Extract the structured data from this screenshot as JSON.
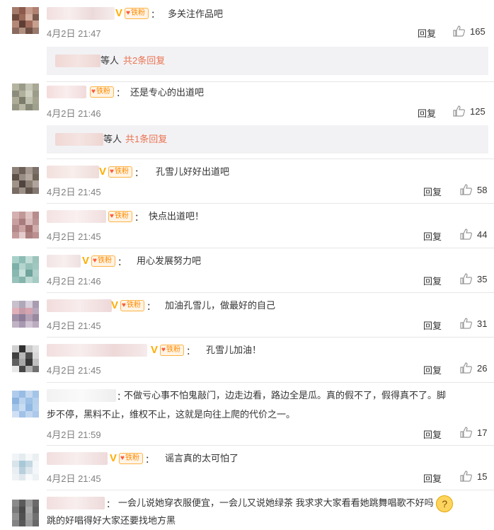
{
  "comments": [
    {
      "text": "多关注作品吧",
      "time": "4月2日 21:47",
      "reply": "回复",
      "likes": "165"
    },
    {
      "text": "还是专心的出道吧",
      "time": "4月2日 21:46",
      "reply": "回复",
      "likes": "125"
    },
    {
      "text": "孔雪儿好好出道吧",
      "time": "4月2日 21:45",
      "reply": "回复",
      "likes": "58"
    },
    {
      "text": "快点出道吧！",
      "time": "4月2日 21:45",
      "reply": "回复",
      "likes": "44"
    },
    {
      "text": "用心发展努力吧",
      "time": "4月2日 21:46",
      "reply": "回复",
      "likes": "35"
    },
    {
      "text": "加油孔雪儿，做最好的自己",
      "time": "4月2日 21:45",
      "reply": "回复",
      "likes": "31"
    },
    {
      "text": "孔雪儿加油！",
      "time": "4月2日 21:45",
      "reply": "回复",
      "likes": "26"
    },
    {
      "text_line1": "不做亏心事不怕鬼敲门，边走边看，路边全是瓜。真的假不了，假得真不了。脚",
      "text_line2": "步不停，黑料不止，维权不止，这就是向往上爬的代价之一。",
      "time": "4月2日 21:59",
      "reply": "回复",
      "likes": "17"
    },
    {
      "text": "谣言真的太可怕了",
      "time": "4月2日 21:45",
      "reply": "回复",
      "likes": "15"
    },
    {
      "text_line1": "一会儿说她穿衣服便宜，一会儿又说她绿茶 我求求大家看看她跳舞唱歌不好吗",
      "text_line2": "跳的好唱得好大家还要找地方黑"
    }
  ],
  "subreplies": [
    {
      "suffix": "等人",
      "count": "共2条回复"
    },
    {
      "suffix": "等人",
      "count": "共1条回复"
    }
  ],
  "fan_badge": "铁粉",
  "colon": "：",
  "vip_mark": "V",
  "emoji_label": "?",
  "colors": {
    "link": "#eb7350",
    "gray": "#808080",
    "vip": "#ffad00"
  },
  "icons": [
    "thumbs-up-icon",
    "v-badge-icon",
    "fan-badge-icon",
    "thinking-emoji-icon"
  ]
}
